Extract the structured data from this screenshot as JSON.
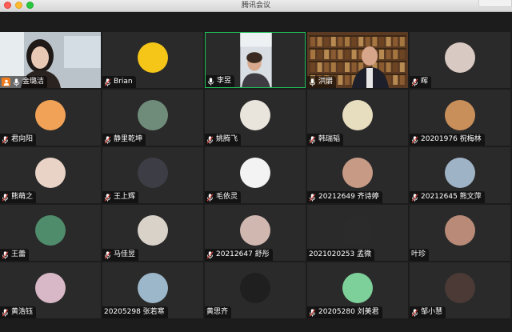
{
  "window": {
    "title": "腾讯会议"
  },
  "participants": [
    {
      "name": "金璐洁",
      "kind": "video",
      "mic": "on",
      "host": true
    },
    {
      "name": "Brian",
      "kind": "avatar",
      "mic": "muted",
      "avatar_color": "#f5c518"
    },
    {
      "name": "李昱",
      "kind": "video",
      "mic": "on",
      "active": true
    },
    {
      "name": "洪爝",
      "kind": "video",
      "mic": "on"
    },
    {
      "name": "晖",
      "kind": "avatar",
      "mic": "muted",
      "avatar_color": "#d9c9c3"
    },
    {
      "name": "君向阳",
      "kind": "avatar",
      "mic": "muted",
      "avatar_color": "#f1a257"
    },
    {
      "name": "静里乾坤",
      "kind": "avatar",
      "mic": "muted",
      "avatar_color": "#6f8c7a"
    },
    {
      "name": "姚腾飞",
      "kind": "avatar",
      "mic": "muted",
      "avatar_color": "#e9e4dc"
    },
    {
      "name": "韩瑞韬",
      "kind": "avatar",
      "mic": "muted",
      "avatar_color": "#e7ddbf"
    },
    {
      "name": "20201976 祝梅林",
      "kind": "avatar",
      "mic": "muted",
      "avatar_color": "#c98f5b"
    },
    {
      "name": "熊萌之",
      "kind": "avatar",
      "mic": "muted",
      "avatar_color": "#e8d3c6"
    },
    {
      "name": "王上辉",
      "kind": "avatar",
      "mic": "muted",
      "avatar_color": "#3d3d46"
    },
    {
      "name": "毛依灵",
      "kind": "avatar",
      "mic": "muted",
      "avatar_color": "#f3f3f3"
    },
    {
      "name": "20212649 齐诗婷",
      "kind": "avatar",
      "mic": "muted",
      "avatar_color": "#c79a86"
    },
    {
      "name": "20212645 熊文萍",
      "kind": "avatar",
      "mic": "muted",
      "avatar_color": "#9fb3c6"
    },
    {
      "name": "王蕾",
      "kind": "avatar",
      "mic": "muted",
      "avatar_color": "#4f8c6b"
    },
    {
      "name": "马佳昱",
      "kind": "avatar",
      "mic": "muted",
      "avatar_color": "#d8d2c8"
    },
    {
      "name": "20212647 舒彤",
      "kind": "avatar",
      "mic": "muted",
      "avatar_color": "#d0b7b0"
    },
    {
      "name": "2021020253 孟微",
      "kind": "avatar",
      "mic": "none",
      "avatar_color": "#2b2b2b"
    },
    {
      "name": "叶珍",
      "kind": "avatar",
      "mic": "none",
      "avatar_color": "#b88a77"
    },
    {
      "name": "黄浩钰",
      "kind": "avatar",
      "mic": "muted",
      "avatar_color": "#d8b8c6"
    },
    {
      "name": "20205298 张若寒",
      "kind": "avatar",
      "mic": "none",
      "avatar_color": "#9cb7c9"
    },
    {
      "name": "黄思齐",
      "kind": "avatar",
      "mic": "none",
      "avatar_color": "#1f1f1f"
    },
    {
      "name": "20205280 刘美君",
      "kind": "avatar",
      "mic": "muted",
      "avatar_color": "#7ed09a"
    },
    {
      "name": "邹小慧",
      "kind": "avatar",
      "mic": "muted",
      "avatar_color": "#4b3a36"
    }
  ],
  "colors": {
    "active_border": "#1fbf58",
    "host_badge": "#f07c1c",
    "mic_on": "#ffffff",
    "mic_muted": "#e0433a"
  }
}
